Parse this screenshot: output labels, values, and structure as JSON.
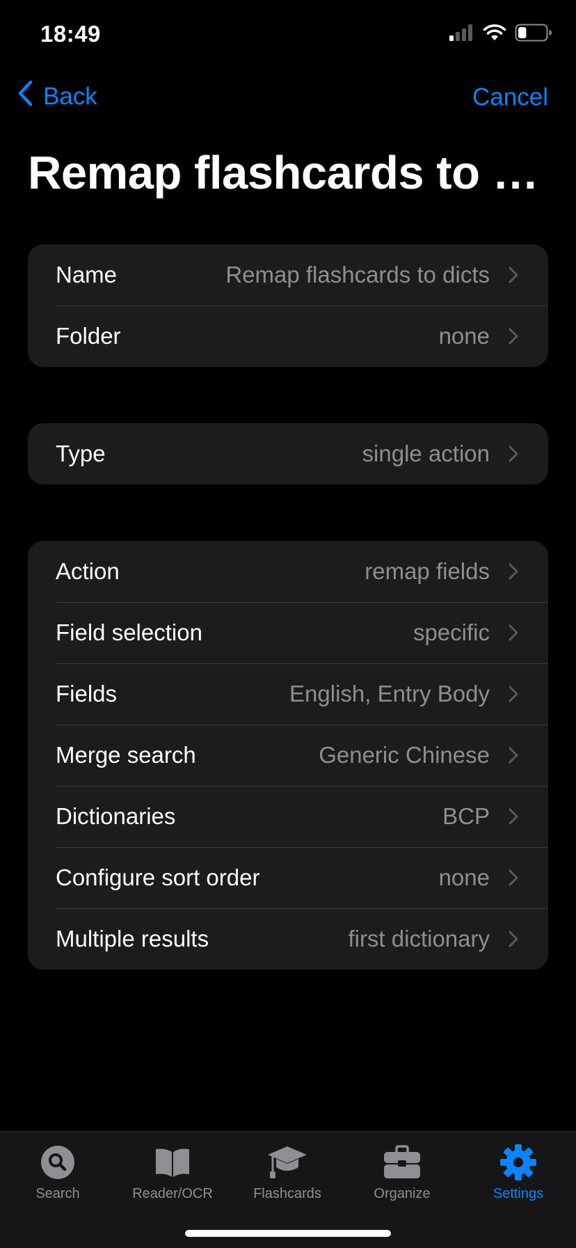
{
  "status_bar": {
    "time": "18:49",
    "icons": [
      "cellular-signal-icon",
      "wifi-icon",
      "battery-icon"
    ],
    "battery_level": 0.3
  },
  "nav": {
    "back_label": "Back",
    "cancel_label": "Cancel"
  },
  "title": "Remap flashcards to di…",
  "groups": [
    {
      "rows": [
        {
          "label": "Name",
          "value": "Remap flashcards to dicts"
        },
        {
          "label": "Folder",
          "value": "none"
        }
      ]
    },
    {
      "rows": [
        {
          "label": "Type",
          "value": "single action"
        }
      ]
    },
    {
      "rows": [
        {
          "label": "Action",
          "value": "remap fields"
        },
        {
          "label": "Field selection",
          "value": "specific"
        },
        {
          "label": "Fields",
          "value": "English, Entry Body"
        },
        {
          "label": "Merge search",
          "value": "Generic Chinese"
        },
        {
          "label": "Dictionaries",
          "value": "BCP"
        },
        {
          "label": "Configure sort order",
          "value": "none"
        },
        {
          "label": "Multiple results",
          "value": "first dictionary"
        }
      ]
    }
  ],
  "tabs": [
    {
      "label": "Search",
      "icon": "search-icon",
      "active": false
    },
    {
      "label": "Reader/OCR",
      "icon": "book-icon",
      "active": false
    },
    {
      "label": "Flashcards",
      "icon": "graduation-cap-icon",
      "active": false
    },
    {
      "label": "Organize",
      "icon": "toolbox-icon",
      "active": false
    },
    {
      "label": "Settings",
      "icon": "gear-icon",
      "active": true
    }
  ],
  "colors": {
    "accent": "#0a84ff",
    "background": "#000000",
    "cell_background": "#1c1c1e",
    "secondary_text": "#8e8e93",
    "inactive_tab": "#8e8e93"
  }
}
